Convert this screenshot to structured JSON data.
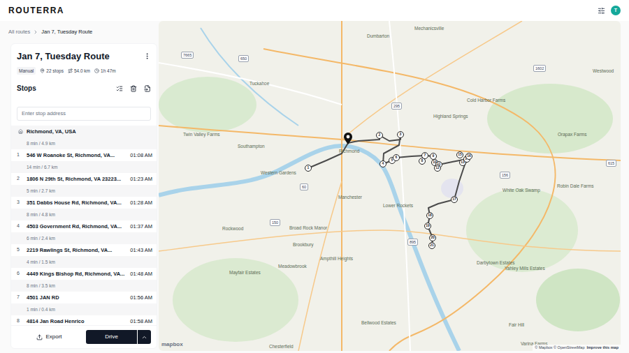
{
  "header": {
    "logo": "ROUTERRA",
    "avatar": "T"
  },
  "breadcrumb": [
    {
      "label": "All routes",
      "selected": false
    },
    {
      "label": "Jan 7, Tuesday Route",
      "selected": true
    }
  ],
  "route": {
    "title": "Jan 7, Tuesday Route",
    "badge": "Manual",
    "stops": "22 stops",
    "distance": "54.0 km",
    "duration": "1h 47m"
  },
  "stops_panel": {
    "heading": "Stops",
    "placeholder": "Enter stop address",
    "start": "Richmond, VA, USA",
    "items": [
      {
        "leg": "8 min / 4.9 km",
        "number": "1",
        "address": "546 W Roanoke St, Richmond, VA...",
        "time": "01:08 AM"
      },
      {
        "leg": "14 min / 6.7 km",
        "number": "2",
        "address": "1806 N 29th St, Richmond, VA 23223...",
        "time": "01:23 AM"
      },
      {
        "leg": "5 min / 2.7 km",
        "number": "3",
        "address": "351 Dabbs House Rd, Richmond, VA...",
        "time": "01:28 AM"
      },
      {
        "leg": "8 min / 4.8 km",
        "number": "4",
        "address": "4503 Government Rd, Richmond, VA...",
        "time": "01:37 AM"
      },
      {
        "leg": "6 min / 2.4 km",
        "number": "5",
        "address": "2219 Rawlings St, Richmond, VA...",
        "time": "01:43 AM"
      },
      {
        "leg": "4 min / 1.5 km",
        "number": "6",
        "address": "4449 Kings Bishop Rd, Richmond, VA...",
        "time": "01:48 AM"
      },
      {
        "leg": "8 min / 3.5 km",
        "number": "7",
        "address": "4501 JAN RD",
        "time": "01:56 AM"
      },
      {
        "leg": "1 min / 0.4 km",
        "number": "8",
        "address": "4814 Jan Road Henrico",
        "time": "01:58 AM"
      }
    ]
  },
  "footer": {
    "export": "Export",
    "drive": "Drive"
  },
  "map": {
    "labels": [
      "Dumbarton",
      "Mechanicsville",
      "Tuckahoe",
      "Highland Springs",
      "Richmond",
      "Manchester",
      "Rockwood",
      "Meadowbrook",
      "Chesterfield",
      "Westwood",
      "Cold Harbor Farms",
      "Orapax Farms",
      "Robin Dale Farms",
      "White Oak Swamp",
      "Darbytown Estates",
      "Yahley Mills Estates",
      "Twin Valley Farms",
      "Brookbury",
      "Broad Rock Manor",
      "Lower Rockets",
      "Ampthill Heights",
      "Mayfair Estates",
      "Bellwood Estates",
      "Fair Hill",
      "Varina Farms",
      "Western Gardens",
      "Southampton"
    ],
    "shields": [
      "7665",
      "650",
      "295",
      "60",
      "150",
      "895",
      "156",
      "1602",
      "615"
    ],
    "pins": [
      "1",
      "2",
      "3",
      "4",
      "5",
      "6",
      "7",
      "8",
      "9",
      "10",
      "11",
      "12",
      "13",
      "14",
      "15",
      "16",
      "17",
      "18",
      "19",
      "20",
      "21"
    ],
    "logo": "mapbox",
    "attribution": "© Mapbox © OpenStreetMap",
    "improve": "Improve this map"
  }
}
